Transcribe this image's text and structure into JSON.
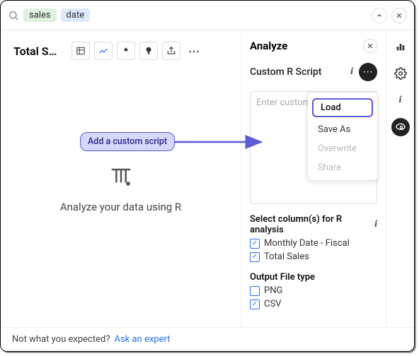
{
  "search": {
    "chips": [
      "sales",
      "date"
    ]
  },
  "left": {
    "title": "Total S…",
    "empty_caption": "Analyze your data using R"
  },
  "analyze": {
    "title": "Analyze",
    "script_label": "Custom R Script",
    "placeholder": "Enter custom script",
    "menu": {
      "load": "Load",
      "save_as": "Save As",
      "overwrite": "Overwrite",
      "share": "Share"
    },
    "columns_label": "Select column(s) for R analysis",
    "columns": [
      {
        "label": "Monthly Date - Fiscal",
        "checked": true
      },
      {
        "label": "Total Sales",
        "checked": true
      }
    ],
    "output_label": "Output File type",
    "outputs": [
      {
        "label": "PNG",
        "checked": false
      },
      {
        "label": "CSV",
        "checked": true
      }
    ]
  },
  "footer": {
    "prompt": "Not what you expected?",
    "link": "Ask an expert"
  },
  "annotation": {
    "text": "Add a custom script"
  }
}
